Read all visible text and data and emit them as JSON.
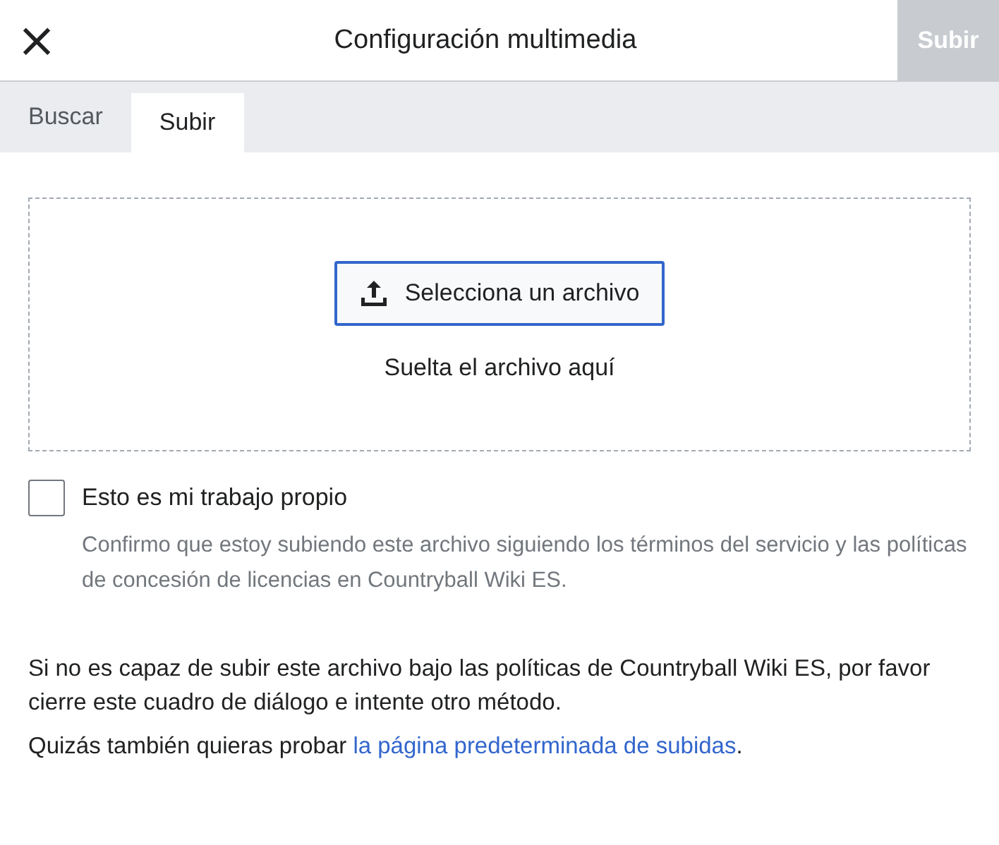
{
  "dialog": {
    "title": "Configuración multimedia",
    "close_label": "×",
    "action": {
      "label": "Subir",
      "disabled": true
    }
  },
  "tabs": [
    {
      "label": "Buscar",
      "selected": false
    },
    {
      "label": "Subir",
      "selected": true
    }
  ],
  "dropzone": {
    "button": "Selecciona un archivo",
    "hint": "Suelta el archivo aquí"
  },
  "own_work": {
    "label": "Esto es mi trabajo propio",
    "checked": false,
    "help": "Confirmo que estoy subiendo este archivo siguiendo los términos del servicio y las políticas de concesión de licencias en Countryball Wiki ES."
  },
  "notice": "Si no es capaz de subir este archivo bajo las políticas de Countryball Wiki ES, por favor cierre este cuadro de diálogo e intente otro método.",
  "alternative": {
    "text": "Quizás también quieras probar ",
    "link": "la página predeterminada de subidas",
    "end": "."
  }
}
